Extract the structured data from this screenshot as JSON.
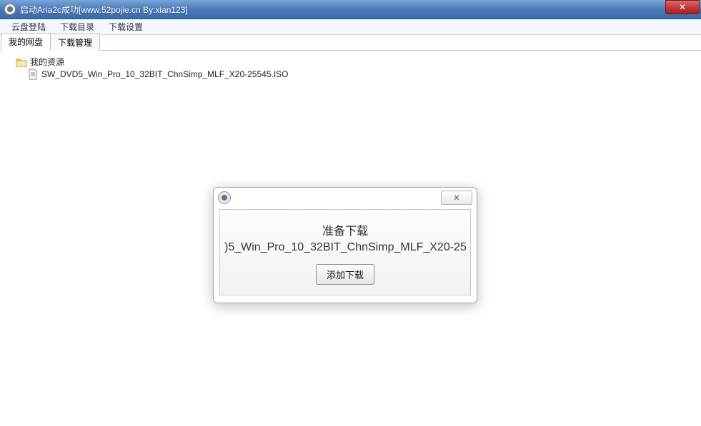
{
  "titlebar": {
    "text": "启动Aria2c成功[www.52pojie.cn By:xian123]"
  },
  "menubar": {
    "items": [
      "云盘登陆",
      "下载目录",
      "下载设置"
    ]
  },
  "tabs": [
    {
      "label": "我的网盘",
      "active": true
    },
    {
      "label": "下载管理",
      "active": false
    }
  ],
  "tree": {
    "root": {
      "label": "我的资源"
    },
    "file": {
      "label": "SW_DVD5_Win_Pro_10_32BIT_ChnSimp_MLF_X20-25545.ISO"
    }
  },
  "dialog": {
    "line1": "准备下载",
    "line2": ")5_Win_Pro_10_32BIT_ChnSimp_MLF_X20-25",
    "button": "添加下载",
    "close_glyph": "✕"
  },
  "winclose_glyph": "✕"
}
